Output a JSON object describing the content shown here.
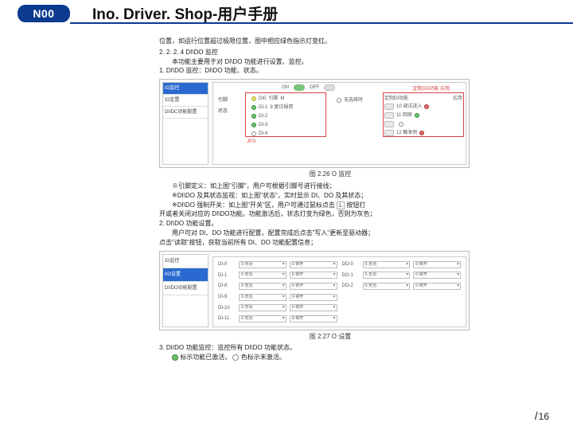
{
  "header": {
    "logo": "N00",
    "title": "Ino. Driver. Shop-用户手册"
  },
  "content": {
    "p1": "位置，如运行位置超过极限位置，图中相应绿色指示灯变红。",
    "p2": "2. 2. 2. 4 DI\\DO 监控",
    "p3": "本功能主要用于对 DI\\DO 功能进行设置、监控。",
    "p4": "1. DI\\DO 监控：DI\\DO 功能、状态。",
    "notes": {
      "n1": "※引脚定义：如上图\"引脚\"，用户可根据引脚号进行接线；",
      "n2": "※DI\\DO 及其状态监视：如上图\"状态\"，实时显示 DI、DO 及其状态；",
      "n3a": "※DI\\DO 强制开关：如上图\"开关\"区，用户可通过鼠标点击",
      "n3b": "按钮打",
      "n4": "开或者关闭对应的 DI\\DO功能。功能激活后，状态灯变为绿色，否则为灰色；",
      "n5": "2. DI\\DO 功能设置。",
      "n6": "用户可对 DI、DO 功能进行配置，配置完成后点击\"写入\"更新至驱动器；",
      "n7": "点击\"读取\"按钮，获取当前所有 DI、DO 功能配置信息；"
    },
    "last": {
      "l1": "3. DI/DO 功能监控：监控所有 DI\\DO 功能状态。",
      "l2a": "标示功能已激活，",
      "l2b": "色标示未激活。"
    }
  },
  "fig1": {
    "caption": "图 2.26 O 监控",
    "side": [
      "IO监控",
      "IO定置",
      "DI/DC功能配置"
    ],
    "on": "ON",
    "off": "OFF",
    "sec1": "引脚",
    "sec2": "状态",
    "mid": "无选择时",
    "rhdr_l": "定制DI功能",
    "rhdr_r": "劣用",
    "annot_l": "JP.5",
    "annot_r": "定制DO功能 劣用",
    "pins": [
      {
        "a": "DI0",
        "b": "引脚",
        "c": "M",
        "dot": "y"
      },
      {
        "a": "DI-1",
        "b": "9 复位报用",
        "c": "",
        "dot": "g"
      },
      {
        "a": "DI-2",
        "b": "",
        "c": "",
        "dot": "g"
      },
      {
        "a": "DI-3",
        "b": "",
        "c": "",
        "dot": "g"
      },
      {
        "a": "DI-4",
        "b": "",
        "c": "",
        "dot": ""
      }
    ],
    "right_rows": [
      {
        "a": "10 调试进入",
        "dot": "r"
      },
      {
        "a": "11 回原",
        "dot": "g"
      },
      {
        "a": "",
        "dot": ""
      },
      {
        "a": "12 触发例",
        "dot": "r"
      }
    ]
  },
  "fig2": {
    "caption": "图 2.27 O 设置",
    "side": [
      "IO监控",
      "I/O设置",
      "DI/DO功能配置"
    ],
    "rows_left": [
      {
        "lbl": "DI-0",
        "a": "0-无功",
        "b": "0-常开"
      },
      {
        "lbl": "DI-1",
        "a": "0-无功",
        "b": "0-常开"
      },
      {
        "lbl": "DI-8",
        "a": "0-无功",
        "b": "0-常开"
      },
      {
        "lbl": "DI-9",
        "a": "0-无功",
        "b": "0-常开"
      },
      {
        "lbl": "DI-10",
        "a": "0-无功",
        "b": "0-常开"
      },
      {
        "lbl": "DI-11",
        "a": "0-无功",
        "b": "0-常开"
      }
    ],
    "rows_right": [
      {
        "lbl": "DO-0",
        "a": "0-无功",
        "b": "0-常开"
      },
      {
        "lbl": "DO-1",
        "a": "0-无功",
        "b": "0-常开"
      },
      {
        "lbl": "DO-2",
        "a": "0-无功",
        "b": "0-常开"
      },
      {
        "lbl": "",
        "a": "",
        "b": ""
      },
      {
        "lbl": "",
        "a": "",
        "b": ""
      },
      {
        "lbl": "",
        "a": "",
        "b": ""
      }
    ]
  },
  "page": {
    "cur": "",
    "total": "16"
  }
}
